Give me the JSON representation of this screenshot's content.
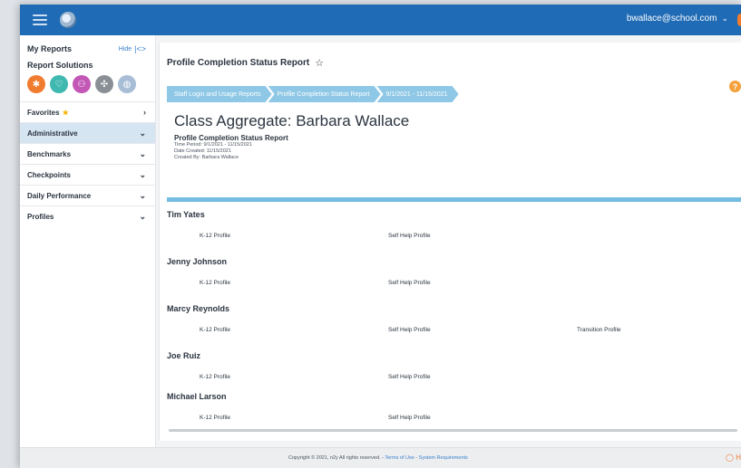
{
  "topbar": {
    "user_email": "bwallace@school.com",
    "caret": "⌄"
  },
  "sidebar": {
    "title": "My Reports",
    "hide_label": "Hide",
    "hide_icon": "|<>",
    "solutions_label": "Report Solutions",
    "solution_icons": [
      {
        "icon": "asterisk-icon",
        "color": "#f07c30",
        "glyph": "✱"
      },
      {
        "icon": "heart-icon",
        "color": "#3fb8b0",
        "glyph": "♡"
      },
      {
        "icon": "person-icon",
        "color": "#c257b6",
        "glyph": "⚇"
      },
      {
        "icon": "puzzle-icon",
        "color": "#8a8f96",
        "glyph": "✣"
      },
      {
        "icon": "globe-icon",
        "color": "#a7bed6",
        "glyph": "◍"
      }
    ],
    "items": [
      {
        "label": "Favorites",
        "star": "★",
        "chevron": "›"
      },
      {
        "label": "Administrative",
        "chevron": "⌄"
      },
      {
        "label": "Benchmarks",
        "chevron": "⌄"
      },
      {
        "label": "Checkpoints",
        "chevron": "⌄"
      },
      {
        "label": "Daily Performance",
        "chevron": "⌄"
      },
      {
        "label": "Profiles",
        "chevron": "⌄"
      }
    ]
  },
  "report": {
    "title": "Profile Completion Status Report",
    "favorite_glyph": "☆",
    "help_glyph": "?",
    "breadcrumbs": [
      "Staff Login and Usage Reports",
      "Profile Completion Status Report",
      "9/1/2021 - 11/15/2021"
    ],
    "aggregate_title": "Class Aggregate: Barbara Wallace",
    "meta_heading": "Profile Completion Status Report",
    "time_period": "Time Period: 9/1/2021 - 11/15/2021",
    "date_created": "Date Created: 11/15/2021",
    "created_by": "Created By: Barbara Wallace"
  },
  "students": [
    {
      "name": "Tim Yates",
      "profiles": [
        "K-12 Profile",
        "Self Help Profile"
      ]
    },
    {
      "name": "Jenny Johnson",
      "profiles": [
        "K-12 Profile",
        "Self Help Profile"
      ]
    },
    {
      "name": "Marcy Reynolds",
      "profiles": [
        "K-12 Profile",
        "Self Help Profile",
        "Transition Profile"
      ]
    },
    {
      "name": "Joe Ruiz",
      "profiles": [
        "K-12 Profile",
        "Self Help Profile"
      ]
    },
    {
      "name": "Michael Larson",
      "profiles": [
        "K-12 Profile",
        "Self Help Profile"
      ]
    }
  ],
  "footer": {
    "copyright": "Copyright © 2021, n2y All rights reserved. -",
    "terms": "Terms of Use",
    "separator": " - ",
    "requirements": "System Requirements",
    "chat_glyph": "◯ H"
  }
}
